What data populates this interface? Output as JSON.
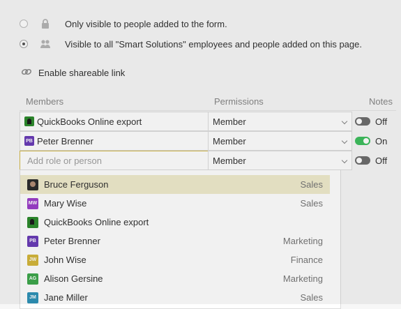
{
  "visibility": {
    "options": [
      {
        "label": "Only visible to people added to the form.",
        "icon": "lock-icon",
        "selected": false
      },
      {
        "label": "Visible to all \"Smart Solutions\" employees and people added on this page.",
        "icon": "people-icon",
        "selected": true
      }
    ]
  },
  "share": {
    "label": "Enable shareable link",
    "icon": "link-icon"
  },
  "table": {
    "headers": {
      "members": "Members",
      "permissions": "Permissions",
      "notes": "Notes"
    },
    "rows": [
      {
        "member": "QuickBooks Online export",
        "avatar": "qb",
        "permission": "Member",
        "notes": "Off",
        "notes_on": false
      },
      {
        "member": "Peter Brenner",
        "avatar": "PB",
        "avatar_color": "#6a3db8",
        "permission": "Member",
        "notes": "On",
        "notes_on": true
      },
      {
        "member_placeholder": "Add role or person",
        "permission": "Member",
        "notes": "Off",
        "notes_on": false
      }
    ]
  },
  "dropdown": {
    "items": [
      {
        "name": "Bruce Ferguson",
        "dept": "Sales",
        "avatar": "photo",
        "highlighted": true
      },
      {
        "name": "Mary Wise",
        "dept": "Sales",
        "avatar": "MW",
        "color": "#9c3fc9"
      },
      {
        "name": "QuickBooks Online export",
        "dept": "",
        "avatar": "qb"
      },
      {
        "name": "Peter Brenner",
        "dept": "Marketing",
        "avatar": "PB",
        "color": "#6a3db8"
      },
      {
        "name": "John Wise",
        "dept": "Finance",
        "avatar": "JW",
        "color": "#d4b73c"
      },
      {
        "name": "Alison Gersine",
        "dept": "Marketing",
        "avatar": "AG",
        "color": "#3fa84d"
      },
      {
        "name": "Jane Miller",
        "dept": "Sales",
        "avatar": "JM",
        "color": "#2f93b8"
      }
    ]
  },
  "colors": {
    "toggle_on": "#3fbf5f",
    "toggle_off": "#6d6d6d",
    "highlight": "#f0ebcd",
    "input_border": "#d4ba4a"
  }
}
